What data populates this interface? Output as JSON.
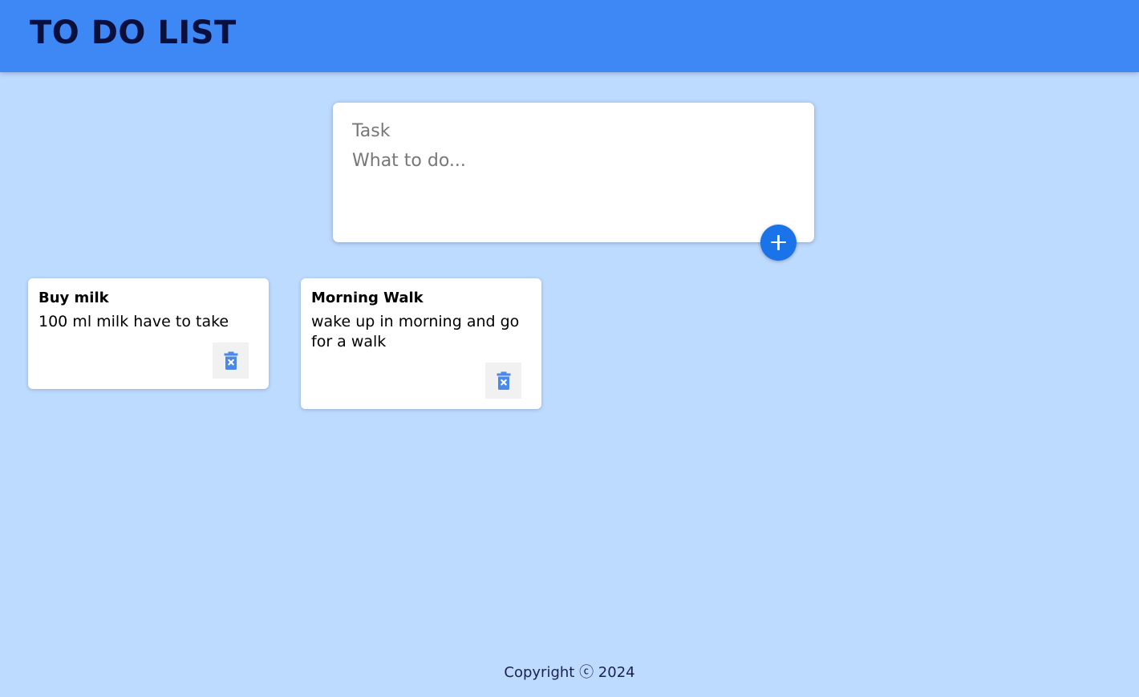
{
  "header": {
    "title": "TO DO LIST"
  },
  "compose": {
    "title_placeholder": "Task",
    "content_placeholder": "What to do...",
    "add_icon": "plus-icon"
  },
  "notes": [
    {
      "title": "Buy milk",
      "content": "100 ml milk have to take",
      "delete_icon": "delete-icon"
    },
    {
      "title": "Morning Walk",
      "content": "wake up in morning and go for a walk",
      "delete_icon": "delete-icon"
    }
  ],
  "footer": {
    "text": "Copyright ⓒ 2024"
  },
  "colors": {
    "header": "#3d88f5",
    "background": "#bddaff",
    "accent": "#1a73e8",
    "delete_icon": "#4a89e8"
  }
}
